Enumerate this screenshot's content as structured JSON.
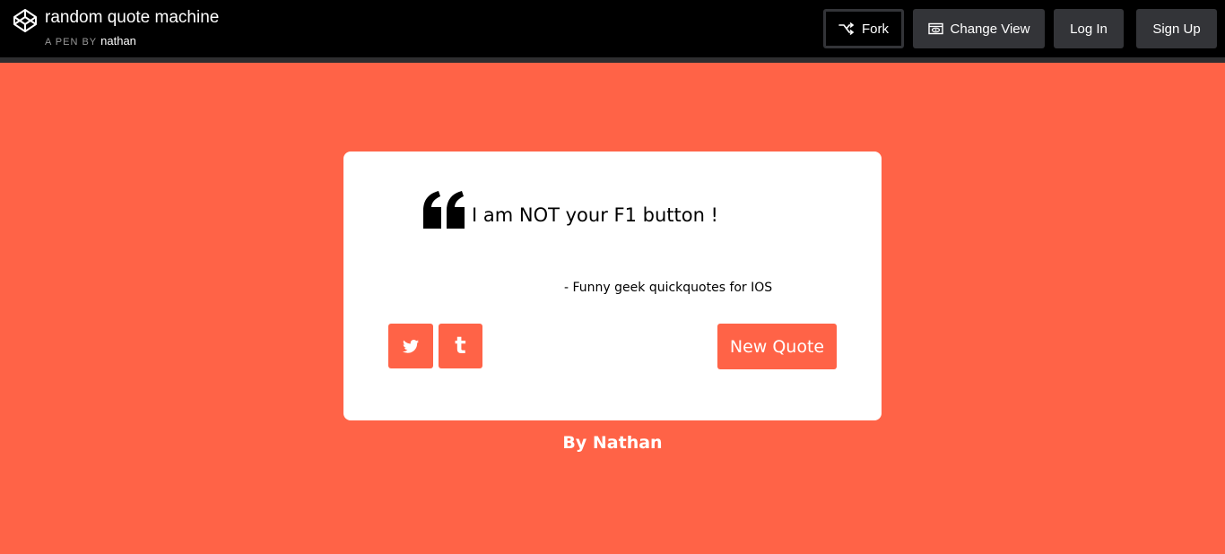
{
  "header": {
    "title": "random quote machine",
    "byline_prefix": "A PEN BY",
    "author": "nathan",
    "logo_icon": "codepen-logo-icon",
    "buttons": {
      "fork": "Fork",
      "change_view": "Change View",
      "log_in": "Log In",
      "sign_up": "Sign Up"
    },
    "icons": {
      "fork": "fork-icon",
      "change_view": "change-view-icon"
    }
  },
  "quote": {
    "text": "I am NOT your F1 button !",
    "author": "- Funny geek quickquotes for IOS",
    "quote_icon": "left-quote-icon"
  },
  "actions": {
    "twitter_icon": "twitter-icon",
    "tumblr_icon": "tumblr-icon",
    "tumblr_glyph": "t",
    "new_quote": "New Quote"
  },
  "footer": {
    "credit": "By Nathan"
  },
  "colors": {
    "background": "#ff6347",
    "topbar": "#000000",
    "button_dark": "#333438",
    "card": "#ffffff"
  }
}
